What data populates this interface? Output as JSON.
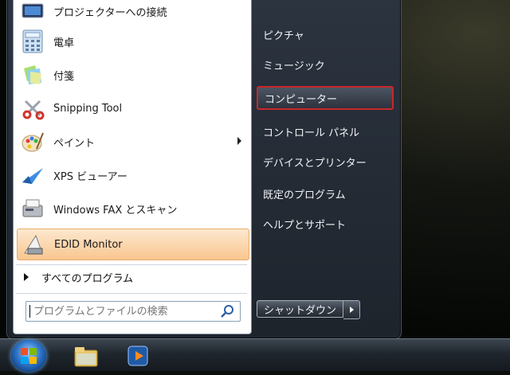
{
  "programs": [
    {
      "label": "プロジェクターへの接続",
      "icon": "projector-icon"
    },
    {
      "label": "電卓",
      "icon": "calculator-icon"
    },
    {
      "label": "付箋",
      "icon": "sticky-notes-icon"
    },
    {
      "label": "Snipping Tool",
      "icon": "scissors-icon"
    },
    {
      "label": "ペイント",
      "icon": "paint-palette-icon"
    },
    {
      "label": "XPS ビューアー",
      "icon": "xps-viewer-icon"
    },
    {
      "label": "Windows FAX とスキャン",
      "icon": "fax-scanner-icon"
    },
    {
      "label": "EDID Monitor",
      "icon": "edid-monitor-icon"
    }
  ],
  "all_programs": "すべてのプログラム",
  "search": {
    "placeholder": "プログラムとファイルの検索"
  },
  "right_links": [
    {
      "label": "ピクチャ"
    },
    {
      "label": "ミュージック"
    },
    {
      "label": "コンピューター"
    },
    {
      "label": "コントロール パネル"
    },
    {
      "label": "デバイスとプリンター"
    },
    {
      "label": "既定のプログラム"
    },
    {
      "label": "ヘルプとサポート"
    }
  ],
  "shutdown": {
    "label": "シャットダウン"
  },
  "taskbar": {
    "items": [
      "start-orb",
      "explorer-folder-icon",
      "media-player-icon"
    ]
  },
  "colors": {
    "highlight": "#f9c68f",
    "selection_border": "#c8272b"
  }
}
